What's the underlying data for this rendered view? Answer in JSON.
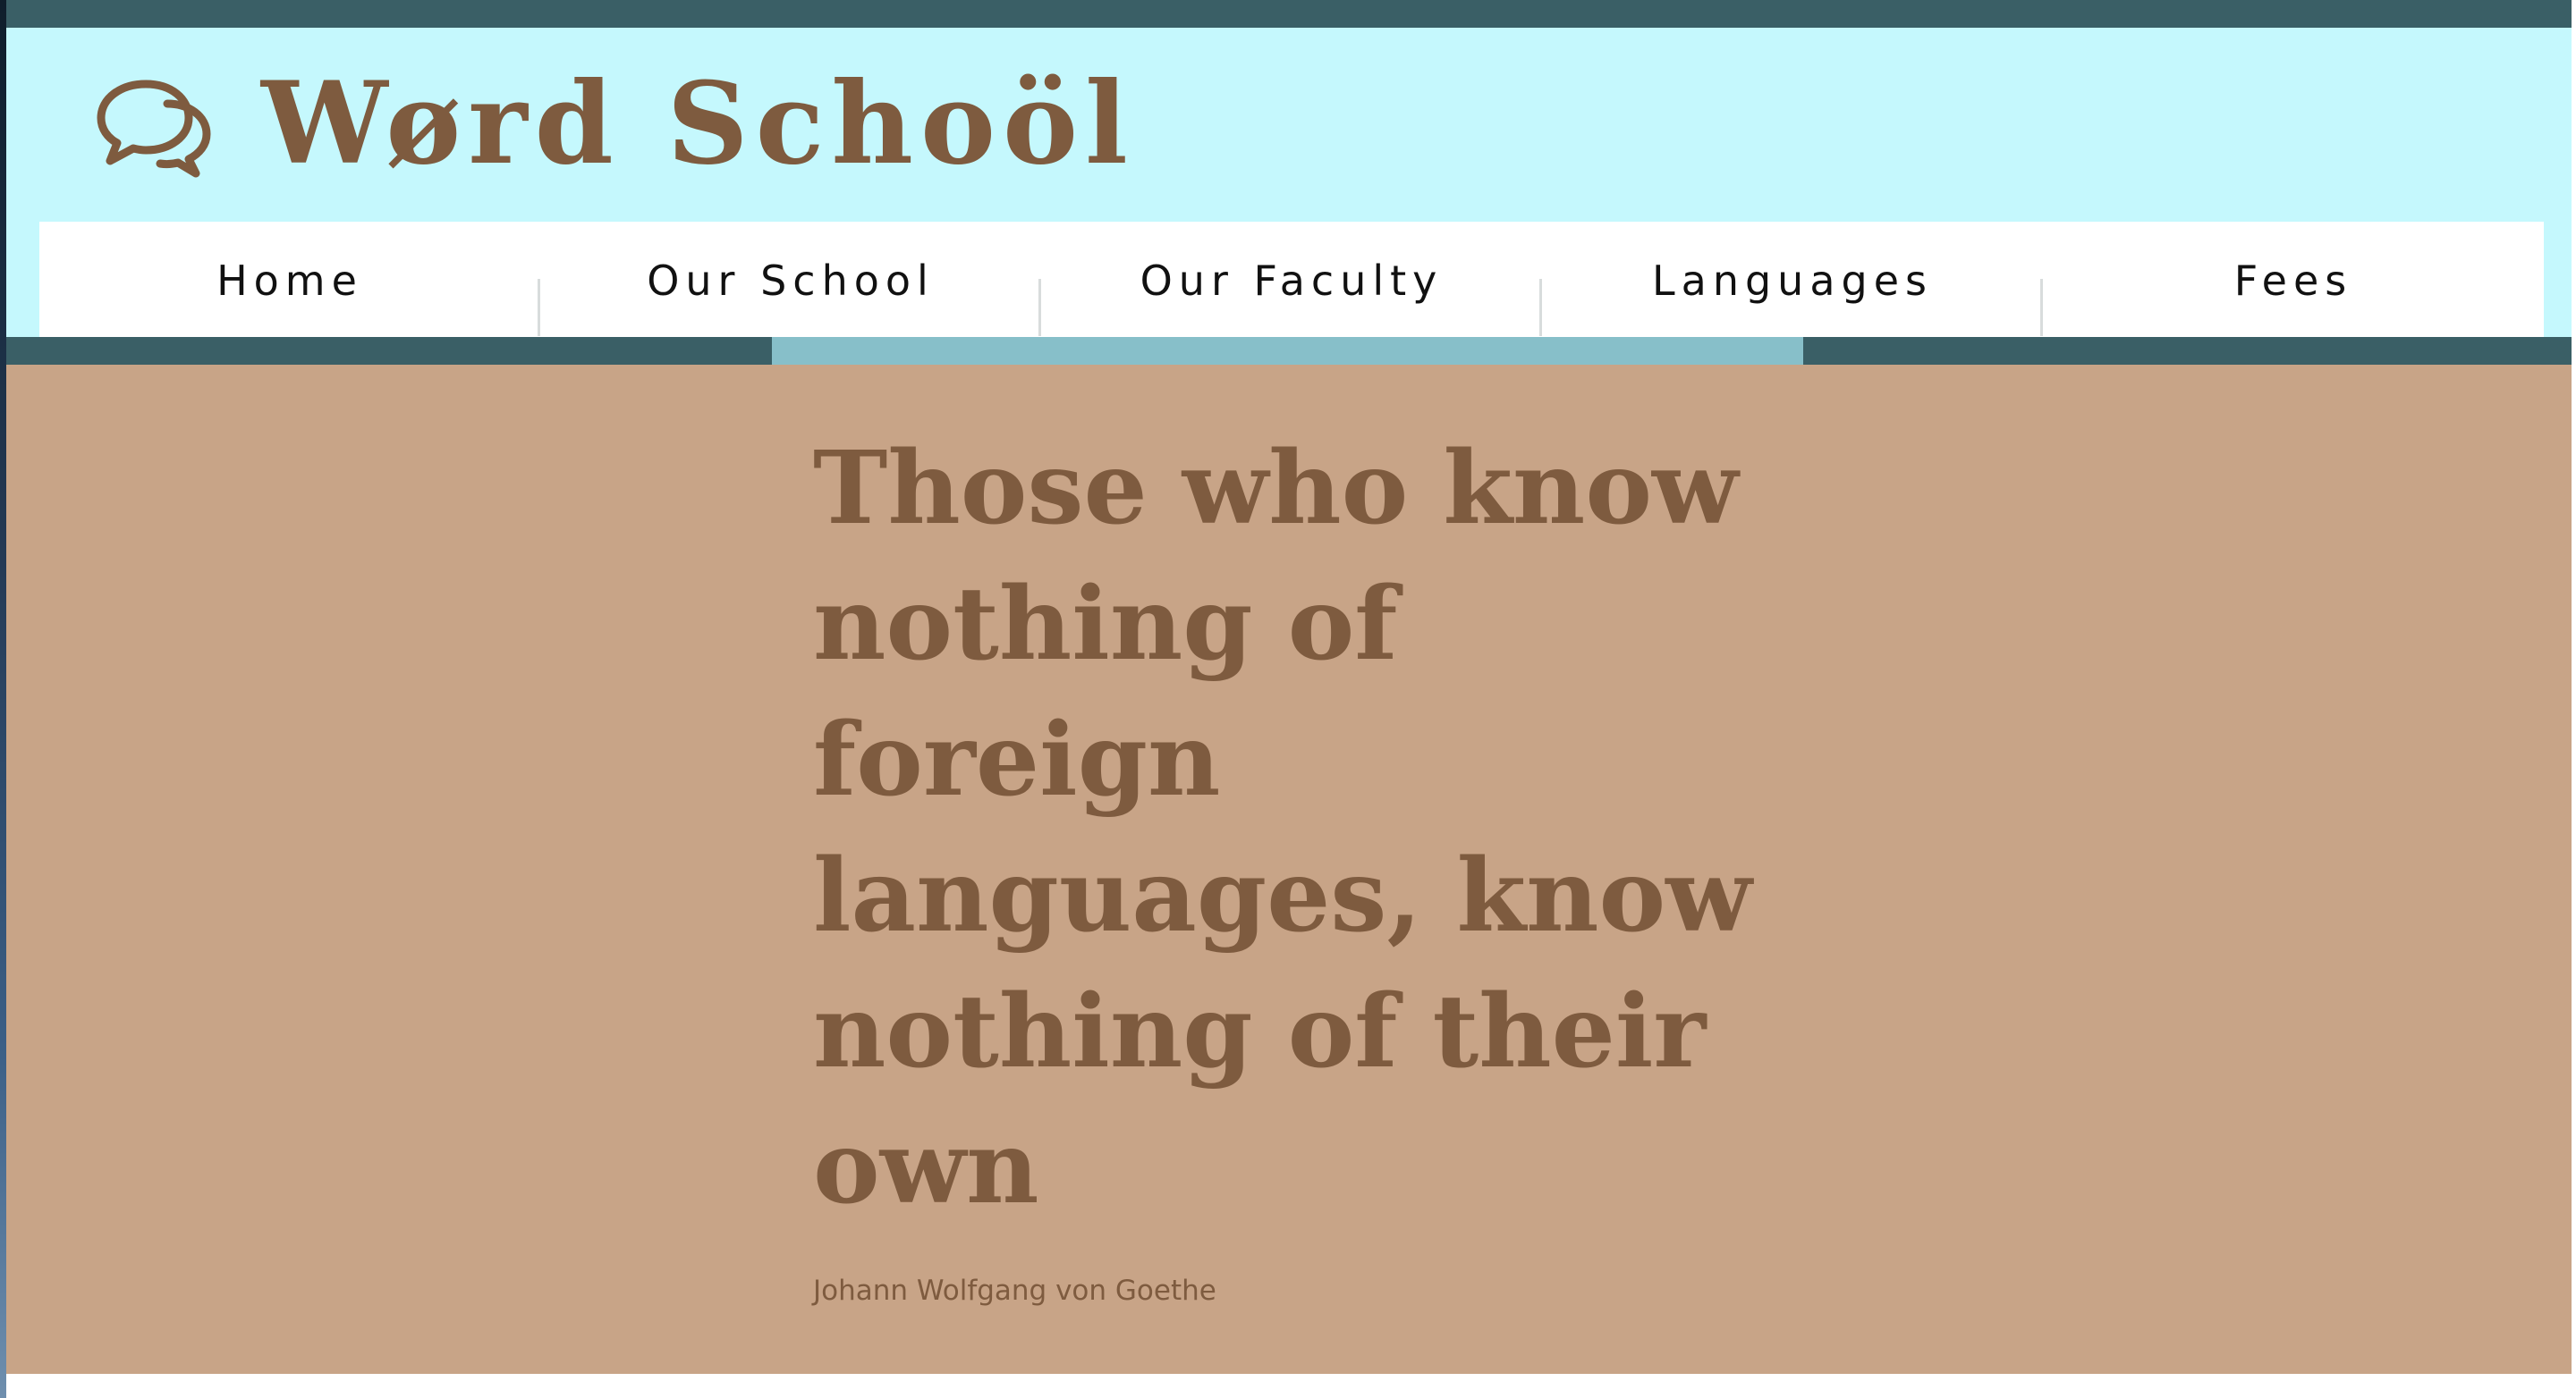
{
  "header": {
    "site_title": "Wørd Schoöl",
    "logo_icon": "speech-bubbles-icon"
  },
  "nav": {
    "items": [
      {
        "label": "Home"
      },
      {
        "label": "Our School"
      },
      {
        "label": "Our Faculty"
      },
      {
        "label": "Languages"
      },
      {
        "label": "Fees"
      }
    ]
  },
  "hero": {
    "quote": "Those who know nothing of foreign languages, know nothing of their own",
    "author": "Johann Wolfgang von Goethe"
  },
  "colors": {
    "brand_brown": "#7e5b3f",
    "header_background": "#c5f8fd",
    "dark_band": "#3a5f66",
    "accent_highlight": "#87bfc9",
    "hero_background": "#c8a487"
  }
}
